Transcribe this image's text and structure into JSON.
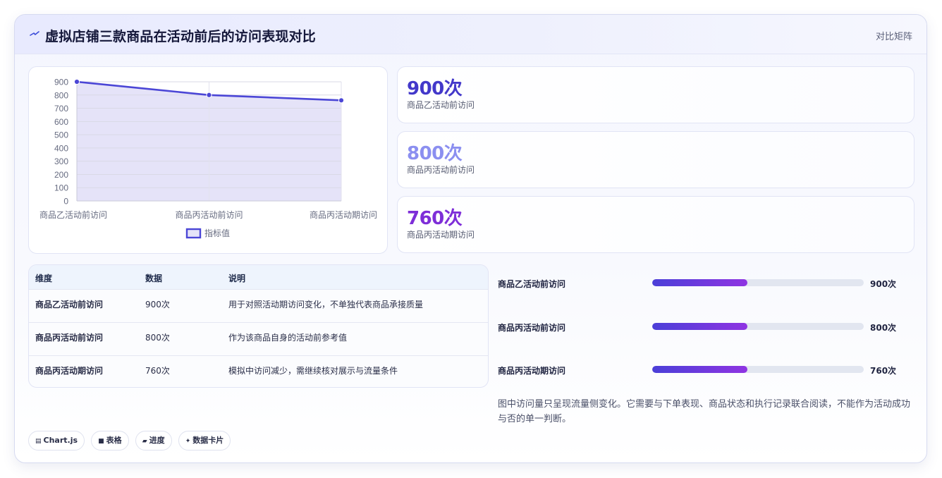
{
  "header": {
    "icon": "spark-icon",
    "title": "虚拟店铺三款商品在活动前后的访问表现对比",
    "mode_label": "对比矩阵"
  },
  "chart_data": {
    "type": "line",
    "categories": [
      "商品乙活动前访问",
      "商品丙活动前访问",
      "商品丙活动期访问"
    ],
    "series": [
      {
        "name": "指标值",
        "values": [
          900,
          800,
          760
        ]
      }
    ],
    "yticks": [
      "0",
      "100",
      "200",
      "300",
      "400",
      "500",
      "600",
      "700",
      "800",
      "900"
    ],
    "ylim": [
      0,
      900
    ],
    "legend_position": "bottom",
    "line_color": "#4b46d6",
    "fill_color": "#e5e3f8",
    "grid": true
  },
  "stats": [
    {
      "value": "900次",
      "label": "商品乙活动前访问",
      "color": "#4338ca"
    },
    {
      "value": "800次",
      "label": "商品丙活动前访问",
      "color": "#8b8ff0"
    },
    {
      "value": "760次",
      "label": "商品丙活动期访问",
      "color": "#7e2ed8"
    }
  ],
  "table": {
    "headers": [
      "维度",
      "数据",
      "说明"
    ],
    "rows": [
      [
        "商品乙活动前访问",
        "900次",
        "用于对照活动期访问变化，不单独代表商品承接质量"
      ],
      [
        "商品丙活动前访问",
        "800次",
        "作为该商品自身的活动前参考值"
      ],
      [
        "商品丙活动期访问",
        "760次",
        "模拟中访问减少，需继续核对展示与流量条件"
      ]
    ]
  },
  "progress": [
    {
      "label": "商品乙活动前访问",
      "value_text": "900次",
      "fraction": 0.45
    },
    {
      "label": "商品丙活动前访问",
      "value_text": "800次",
      "fraction": 0.45
    },
    {
      "label": "商品丙活动期访问",
      "value_text": "760次",
      "fraction": 0.45
    }
  ],
  "note": "图中访问量只呈现流量侧变化。它需要与下单表现、商品状态和执行记录联合阅读，不能作为活动成功与否的单一判断。",
  "tags": [
    {
      "icon": "chart-icon",
      "label": "Chart.js"
    },
    {
      "icon": "table-icon",
      "label": "表格"
    },
    {
      "icon": "progress-icon",
      "label": "进度"
    },
    {
      "icon": "card-icon",
      "label": "数据卡片"
    }
  ]
}
